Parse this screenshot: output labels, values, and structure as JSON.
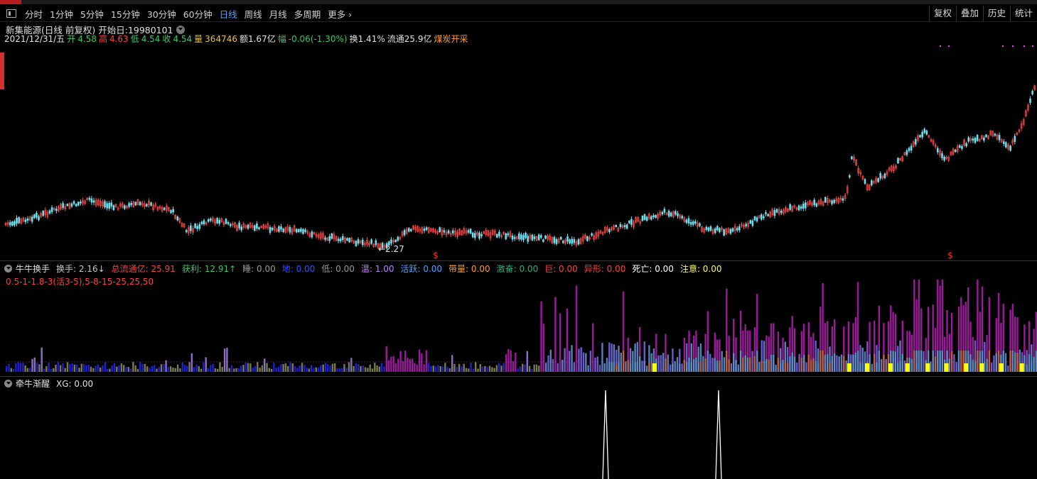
{
  "period_bar": {
    "tabs": [
      "分时",
      "1分钟",
      "5分钟",
      "15分钟",
      "30分钟",
      "60分钟",
      "日线",
      "周线",
      "月线",
      "多周期",
      "更多 ›"
    ],
    "active_tab": "日线",
    "right_buttons": [
      "复权",
      "叠加",
      "历史",
      "统计"
    ]
  },
  "stock": {
    "title": "新集能源(日线 前复权) 开始日:19980101",
    "date": "2021/12/31/五",
    "open_label": "开",
    "open": "4.58",
    "high_label": "高",
    "high": "4.63",
    "low_label": "低",
    "low": "4.54",
    "close_label": "收",
    "close": "4.54",
    "vol_label": "量",
    "vol": "364746",
    "amt": "额1.67亿",
    "chg_label": "幅",
    "chg": "-0.06(-1.30%)",
    "turnover": "换1.41%",
    "float": "流通25.9亿",
    "sector": "煤炭开采"
  },
  "main_chart": {
    "low_marker": "←2.27",
    "signal_marker": "$"
  },
  "indicator1": {
    "name": "牛牛换手",
    "items": [
      {
        "label": "换手: 2.16↓",
        "color": "#c8c8c8"
      },
      {
        "label": "总流通亿: 25.91",
        "color": "#ff4040"
      },
      {
        "label": "获利: 12.91↑",
        "color": "#3cc46a"
      },
      {
        "label": "睡: 0.00",
        "color": "#9a9a9a"
      },
      {
        "label": "地: 0.00",
        "color": "#3050ff"
      },
      {
        "label": "低: 0.00",
        "color": "#9a9a9a"
      },
      {
        "label": "温: 1.00",
        "color": "#c080ff"
      },
      {
        "label": "活跃: 0.00",
        "color": "#4fa3ff"
      },
      {
        "label": "带量: 0.00",
        "color": "#ff9a2e"
      },
      {
        "label": "激奋: 0.00",
        "color": "#30b080"
      },
      {
        "label": "巨: 0.00",
        "color": "#ff4040"
      },
      {
        "label": "异形: 0.00",
        "color": "#ff4040"
      },
      {
        "label": "死亡: 0.00",
        "color": "#ffffff"
      },
      {
        "label": "注意: 0.00",
        "color": "#ffff66"
      }
    ],
    "params": "0.5-1-1.8-3(活3-5),5-8-15-25,25,50"
  },
  "indicator2": {
    "name": "牵牛渐醒",
    "value": "XG: 0.00"
  }
}
